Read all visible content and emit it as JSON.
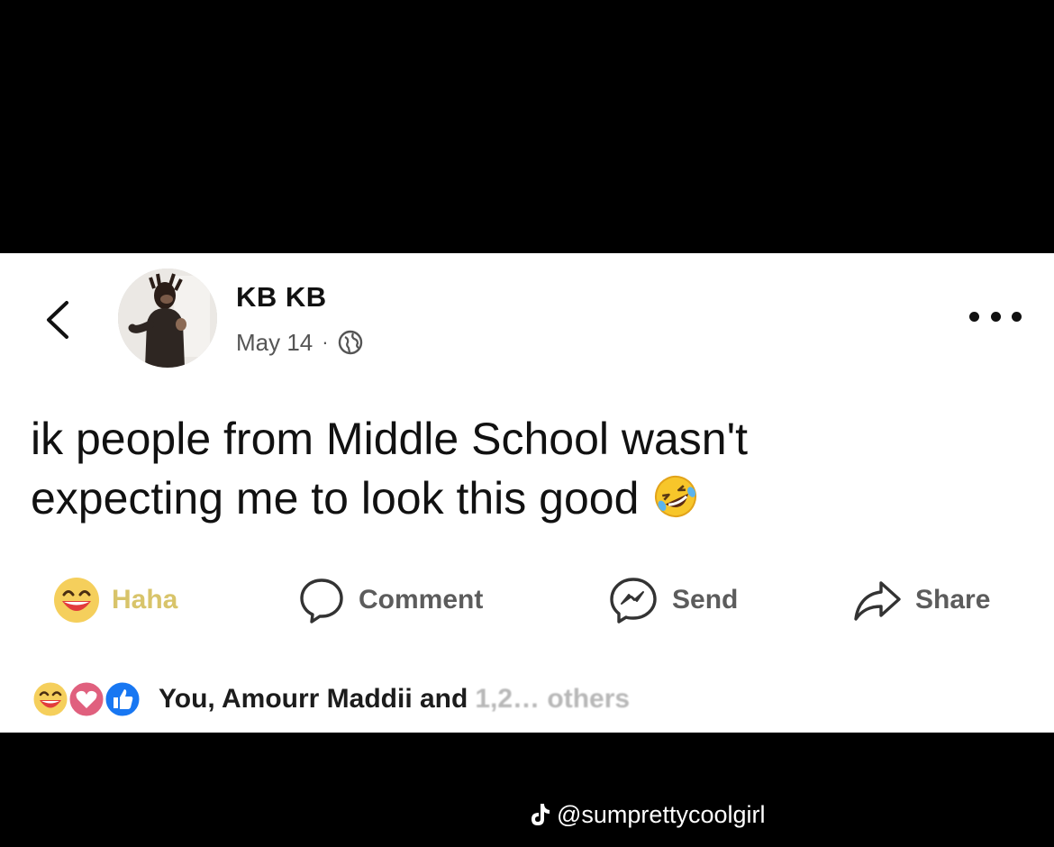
{
  "post": {
    "author": "KB KB",
    "date": "May 14",
    "separator": "·",
    "privacy_icon": "globe-icon",
    "text_line1": "ik people from Middle School wasn't",
    "text_line2": "expecting me to look this good",
    "emoji": "rolling-on-floor-laughing-emoji"
  },
  "actions": {
    "haha": "Haha",
    "comment": "Comment",
    "send": "Send",
    "share": "Share"
  },
  "reactions": {
    "icons": [
      "haha-icon",
      "love-icon",
      "like-icon"
    ],
    "summary": "You, Amourr Maddii and",
    "obscured": "1,2… others"
  },
  "watermark": {
    "handle": "@sumprettycoolgirl",
    "logo": "tiktok-icon"
  },
  "colors": {
    "haha_label": "#d8c46a",
    "love": "#e0607e",
    "like": "#1877f2"
  }
}
